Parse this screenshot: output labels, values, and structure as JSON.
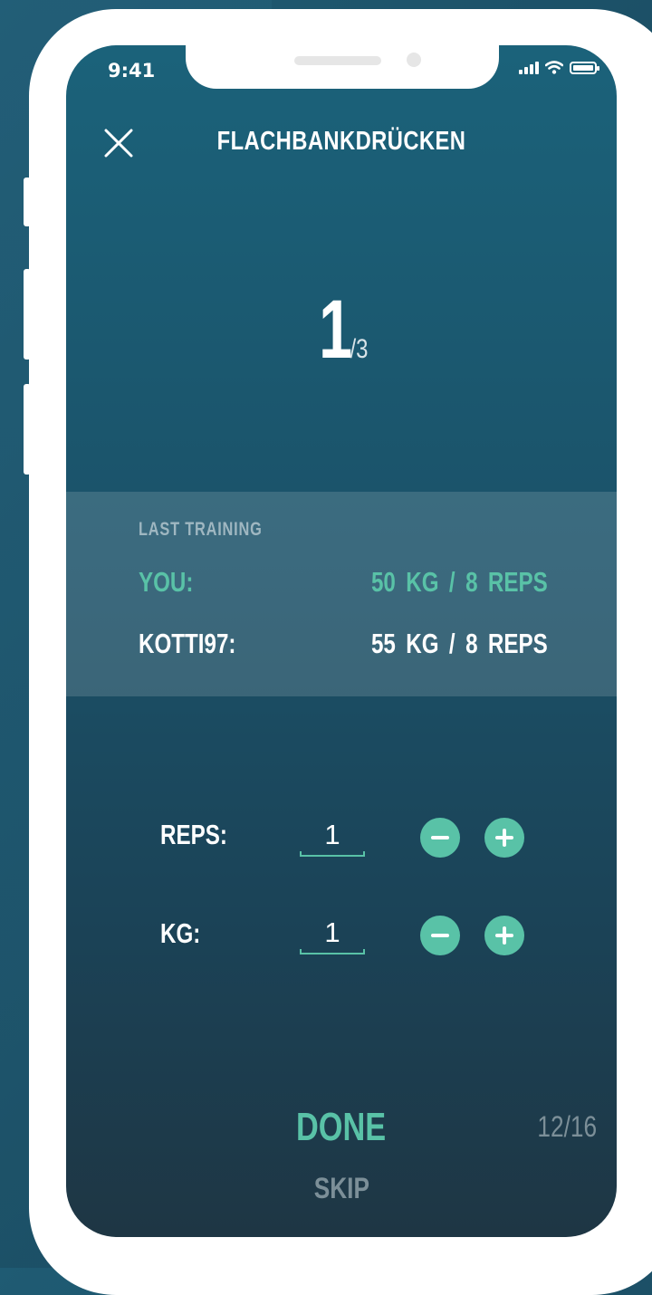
{
  "status_bar": {
    "time": "9:41",
    "icons": [
      "signal-icon",
      "wifi-icon",
      "battery-icon"
    ]
  },
  "header": {
    "close_icon": "close-icon",
    "title": "FLACHBANKDRÜCKEN"
  },
  "set": {
    "current": "1",
    "total": "/3"
  },
  "last_training": {
    "label": "LAST TRAINING",
    "rows": [
      {
        "name": "YOU:",
        "weight": "50 KG",
        "separator": "/",
        "reps": "8 REPS",
        "color": "#59c2a7"
      },
      {
        "name": "KOTTI97:",
        "weight": "55 KG",
        "separator": "/",
        "reps": "8 REPS",
        "color": "#ffffff"
      }
    ]
  },
  "inputs": {
    "reps": {
      "label": "REPS:",
      "value": "1"
    },
    "kg": {
      "label": "KG:",
      "value": "1"
    }
  },
  "actions": {
    "done_label": "DONE",
    "skip_label": "SKIP"
  },
  "progress": {
    "text": "12/16"
  },
  "colors": {
    "accent": "#59c2a7",
    "muted": "#7c8f98",
    "background": "#1b5168"
  }
}
